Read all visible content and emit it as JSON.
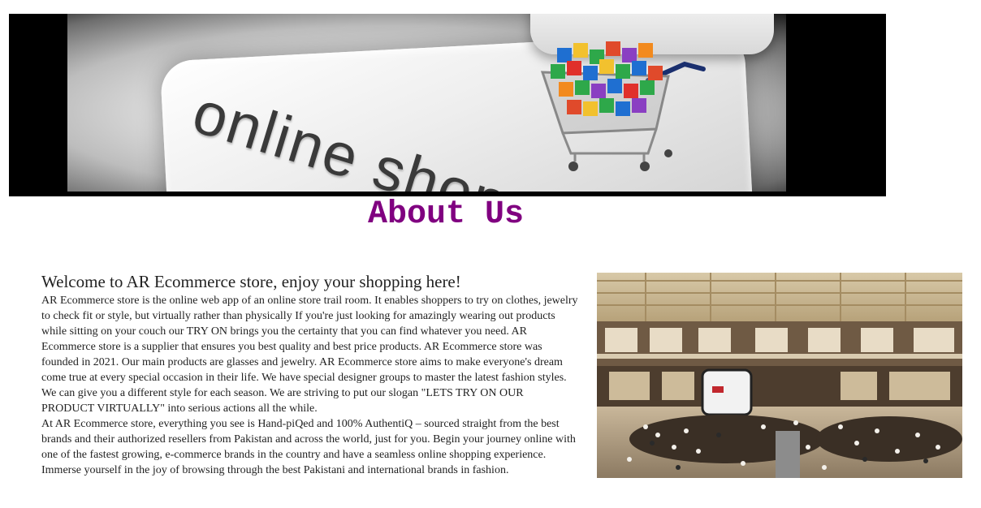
{
  "banner": {
    "text": "online shop",
    "icon": "shopping-cart-icon"
  },
  "heading": "About Us",
  "welcome": "Welcome to AR Ecommerce store, enjoy your shopping here!",
  "paragraph1": "AR Ecommerce store is the online web app of an online store trail room. It enables shoppers to try on clothes, jewelry to check fit or style, but virtually rather than physically If you're just looking for amazingly wearing out products while sitting on your couch our TRY ON brings you the certainty that you can find whatever you need. AR Ecommerce store is a supplier that ensures you best quality and best price products. AR Ecommerce store was founded in 2021. Our main products are glasses and jewelry. AR Ecommerce store aims to make everyone's dream come true at every special occasion in their life. We have special designer groups to master the latest fashion styles. We can give you a different style for each season. We are striving to put our slogan \"LETS TRY ON OUR PRODUCT VIRTUALLY\" into serious actions all the while.",
  "paragraph2": "At AR Ecommerce store, everything you see is Hand-piQed and 100% AuthentiQ – sourced straight from the best brands and their authorized resellers from Pakistan and across the world, just for you. Begin your journey online with one of the fastest growing, e-commerce brands in the country and have a seamless online shopping experience. Immerse yourself in the joy of browsing through the best Pakistani and international brands in fashion.",
  "colors": {
    "heading": "#800080",
    "text": "#222222",
    "banner_bg": "#000000"
  }
}
